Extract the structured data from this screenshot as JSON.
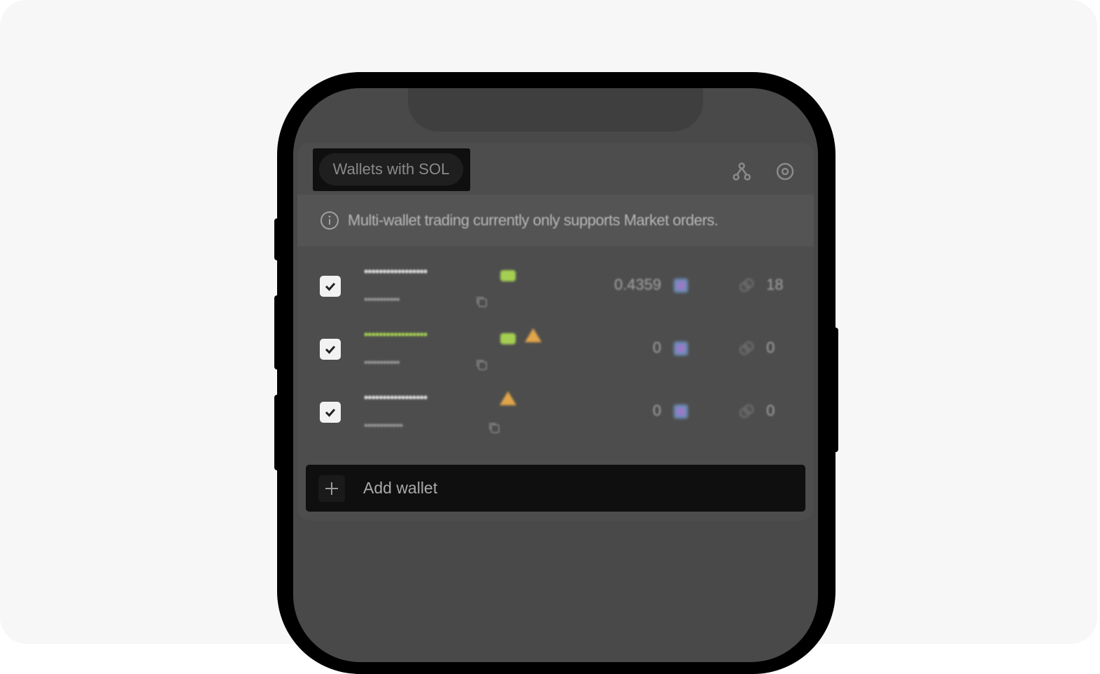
{
  "header": {
    "filter_label": "Wallets with SOL",
    "icons": [
      "fork-icon",
      "settings-icon"
    ]
  },
  "info": {
    "icon": "info-icon",
    "text": "Multi-wallet trading currently only supports Market orders."
  },
  "wallets": [
    {
      "name": "•••••••••••••••••",
      "address": "•••••••••••",
      "balance": "0.4359",
      "count": "18",
      "checked": true,
      "badges": [
        "green-tag"
      ]
    },
    {
      "name": "•••••••••••••••••",
      "address": "•••••••••••",
      "balance": "0",
      "count": "0",
      "checked": true,
      "badges": [
        "green-tag",
        "warning"
      ]
    },
    {
      "name": "•••••••••••••••••",
      "address": "••••••••••••",
      "balance": "0",
      "count": "0",
      "checked": true,
      "badges": [
        "warning"
      ]
    }
  ],
  "add_wallet": {
    "label": "Add wallet",
    "icon": "plus-icon"
  },
  "colors": {
    "accent_green": "#a5cf52",
    "warning": "#e2a64a"
  }
}
